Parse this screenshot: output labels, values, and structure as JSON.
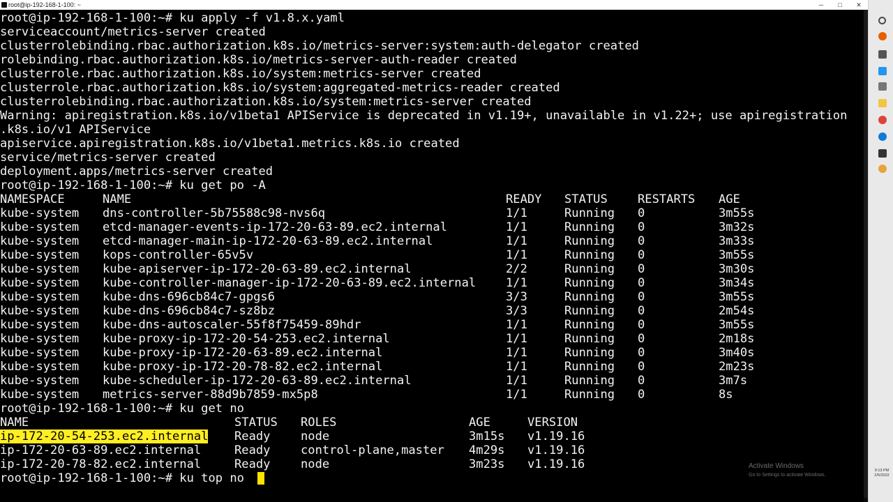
{
  "window": {
    "title": "root@ip-192-168-1-100: ~",
    "buttons": {
      "minimize": "─",
      "maximize": "□",
      "close": "✕"
    }
  },
  "terminal": {
    "lines": [
      "root@ip-192-168-1-100:~# ku apply -f v1.8.x.yaml",
      "serviceaccount/metrics-server created",
      "clusterrolebinding.rbac.authorization.k8s.io/metrics-server:system:auth-delegator created",
      "rolebinding.rbac.authorization.k8s.io/metrics-server-auth-reader created",
      "clusterrole.rbac.authorization.k8s.io/system:metrics-server created",
      "clusterrole.rbac.authorization.k8s.io/system:aggregated-metrics-reader created",
      "clusterrolebinding.rbac.authorization.k8s.io/system:metrics-server created",
      "Warning: apiregistration.k8s.io/v1beta1 APIService is deprecated in v1.19+, unavailable in v1.22+; use apiregistration",
      ".k8s.io/v1 APIService",
      "apiservice.apiregistration.k8s.io/v1beta1.metrics.k8s.io created",
      "service/metrics-server created",
      "deployment.apps/metrics-server created",
      "root@ip-192-168-1-100:~# ku get po -A"
    ],
    "pods": {
      "headers": [
        "NAMESPACE",
        "NAME",
        "READY",
        "STATUS",
        "RESTARTS",
        "AGE"
      ],
      "rows": [
        [
          "kube-system",
          "dns-controller-5b75588c98-nvs6q",
          "1/1",
          "Running",
          "0",
          "3m55s"
        ],
        [
          "kube-system",
          "etcd-manager-events-ip-172-20-63-89.ec2.internal",
          "1/1",
          "Running",
          "0",
          "3m32s"
        ],
        [
          "kube-system",
          "etcd-manager-main-ip-172-20-63-89.ec2.internal",
          "1/1",
          "Running",
          "0",
          "3m33s"
        ],
        [
          "kube-system",
          "kops-controller-65v5v",
          "1/1",
          "Running",
          "0",
          "3m55s"
        ],
        [
          "kube-system",
          "kube-apiserver-ip-172-20-63-89.ec2.internal",
          "2/2",
          "Running",
          "0",
          "3m30s"
        ],
        [
          "kube-system",
          "kube-controller-manager-ip-172-20-63-89.ec2.internal",
          "1/1",
          "Running",
          "0",
          "3m34s"
        ],
        [
          "kube-system",
          "kube-dns-696cb84c7-gpgs6",
          "3/3",
          "Running",
          "0",
          "3m55s"
        ],
        [
          "kube-system",
          "kube-dns-696cb84c7-sz8bz",
          "3/3",
          "Running",
          "0",
          "2m54s"
        ],
        [
          "kube-system",
          "kube-dns-autoscaler-55f8f75459-89hdr",
          "1/1",
          "Running",
          "0",
          "3m55s"
        ],
        [
          "kube-system",
          "kube-proxy-ip-172-20-54-253.ec2.internal",
          "1/1",
          "Running",
          "0",
          "2m18s"
        ],
        [
          "kube-system",
          "kube-proxy-ip-172-20-63-89.ec2.internal",
          "1/1",
          "Running",
          "0",
          "3m40s"
        ],
        [
          "kube-system",
          "kube-proxy-ip-172-20-78-82.ec2.internal",
          "1/1",
          "Running",
          "0",
          "2m23s"
        ],
        [
          "kube-system",
          "kube-scheduler-ip-172-20-63-89.ec2.internal",
          "1/1",
          "Running",
          "0",
          "3m7s"
        ],
        [
          "kube-system",
          "metrics-server-88d9b7859-mx5p8",
          "1/1",
          "Running",
          "0",
          "8s"
        ]
      ]
    },
    "get_no_command": "root@ip-192-168-1-100:~# ku get no",
    "nodes": {
      "headers": [
        "NAME",
        "STATUS",
        "ROLES",
        "AGE",
        "VERSION"
      ],
      "rows": [
        [
          "ip-172-20-54-253.ec2.internal",
          "Ready",
          "node",
          "3m15s",
          "v1.19.16"
        ],
        [
          "ip-172-20-63-89.ec2.internal",
          "Ready",
          "control-plane,master",
          "4m29s",
          "v1.19.16"
        ],
        [
          "ip-172-20-78-82.ec2.internal",
          "Ready",
          "node",
          "3m23s",
          "v1.19.16"
        ]
      ],
      "highlighted_row": 0
    },
    "prompt_line": "root@ip-192-168-1-100:~# ku top no "
  },
  "watermark": {
    "title": "Activate Windows",
    "subtitle": "Go to Settings to activate Windows."
  },
  "taskbar": {
    "time": "9:13 PM",
    "date": "2/5/2022",
    "icons": [
      {
        "name": "search-icon",
        "color": "#4a4a4a"
      },
      {
        "name": "firefox-icon",
        "color": "#e66000"
      },
      {
        "name": "app-grid-icon",
        "color": "#555555"
      },
      {
        "name": "docker-icon",
        "color": "#2496ed"
      },
      {
        "name": "settings-icon",
        "color": "#777777"
      },
      {
        "name": "file-explorer-icon",
        "color": "#f4c542"
      },
      {
        "name": "chrome-icon",
        "color": "#db4437"
      },
      {
        "name": "edge-icon",
        "color": "#0f7bd7"
      },
      {
        "name": "terminal-icon",
        "color": "#333333"
      },
      {
        "name": "circle-app-icon",
        "color": "#e8a33d"
      }
    ],
    "accent": "#0078d7"
  },
  "colors": {
    "terminal_bg": "#000000",
    "terminal_fg": "#f2f2f2",
    "highlight_bg": "#ffee22",
    "cursor": "#ffe200"
  }
}
